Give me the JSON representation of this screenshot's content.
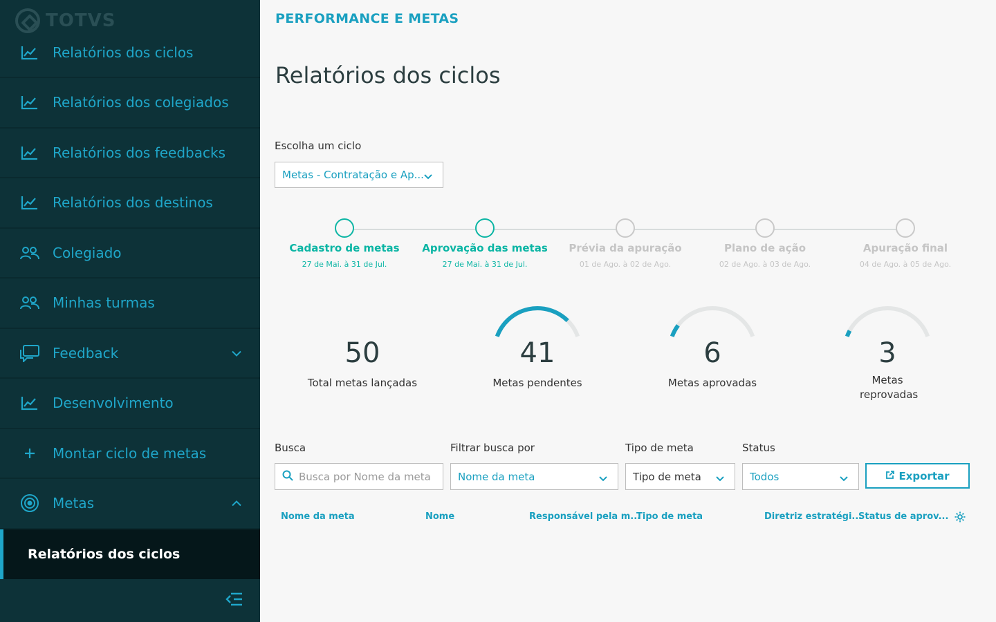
{
  "brand": {
    "logo_text": "TOTVS"
  },
  "sidebar": {
    "items": [
      {
        "label": "Relatórios dos ciclos",
        "icon": "chart-line-icon"
      },
      {
        "label": "Relatórios dos colegiados",
        "icon": "chart-line-icon"
      },
      {
        "label": "Relatórios dos feedbacks",
        "icon": "chart-line-icon"
      },
      {
        "label": "Relatórios dos destinos",
        "icon": "chart-line-icon"
      },
      {
        "label": "Colegiado",
        "icon": "users-icon"
      },
      {
        "label": "Minhas turmas",
        "icon": "users-icon"
      },
      {
        "label": "Feedback",
        "icon": "chat-icon",
        "chevron": "down"
      },
      {
        "label": "Desenvolvimento",
        "icon": "chart-line-icon"
      },
      {
        "label": "Montar ciclo de metas",
        "icon": "plus-icon"
      },
      {
        "label": "Metas",
        "icon": "target-icon",
        "chevron": "up"
      }
    ],
    "active_sub_item": "Relatórios dos ciclos"
  },
  "header": {
    "breadcrumb": "PERFORMANCE E METAS",
    "title": "Relatórios dos ciclos"
  },
  "cycle": {
    "label": "Escolha um ciclo",
    "selected": "Metas - Contratação e Ap..."
  },
  "steps": [
    {
      "name": "Cadastro de metas",
      "date": "27 de Mai. à 31 de Jul.",
      "active": true
    },
    {
      "name": "Aprovação das metas",
      "date": "27 de Mai. à 31 de Jul.",
      "active": true
    },
    {
      "name": "Prévia da apuração",
      "date": "01 de Ago. à 02 de Ago.",
      "active": false
    },
    {
      "name": "Plano de ação",
      "date": "02 de Ago. à 03 de Ago.",
      "active": false
    },
    {
      "name": "Apuração final",
      "date": "04 de Ago. à 05 de Ago.",
      "active": false
    }
  ],
  "stats": [
    {
      "value": "50",
      "label": "Total metas lançadas",
      "fraction": null
    },
    {
      "value": "41",
      "label": "Metas pendentes",
      "fraction": 0.82
    },
    {
      "value": "6",
      "label": "Metas aprovadas",
      "fraction": 0.12
    },
    {
      "value": "3",
      "label": "Metas reprovadas",
      "fraction": 0.06
    }
  ],
  "filters": {
    "search_label": "Busca",
    "search_placeholder": "Busca por Nome da meta",
    "filter_label": "Filtrar busca por",
    "filter_value": "Nome da meta",
    "type_label": "Tipo de meta",
    "type_value": "Tipo de meta",
    "status_label": "Status",
    "status_value": "Todos",
    "export_label": "Exportar"
  },
  "table": {
    "columns": [
      "Nome da meta",
      "Nome",
      "Responsável pela m...",
      "Tipo de meta",
      "Diretriz estratégi...",
      "Status de aprov..."
    ]
  },
  "colors": {
    "sidebar_bg": "#0d3238",
    "accent": "#1aa0c0",
    "step_active": "#0bb5a4",
    "gauge_track": "#e4e6e6"
  }
}
